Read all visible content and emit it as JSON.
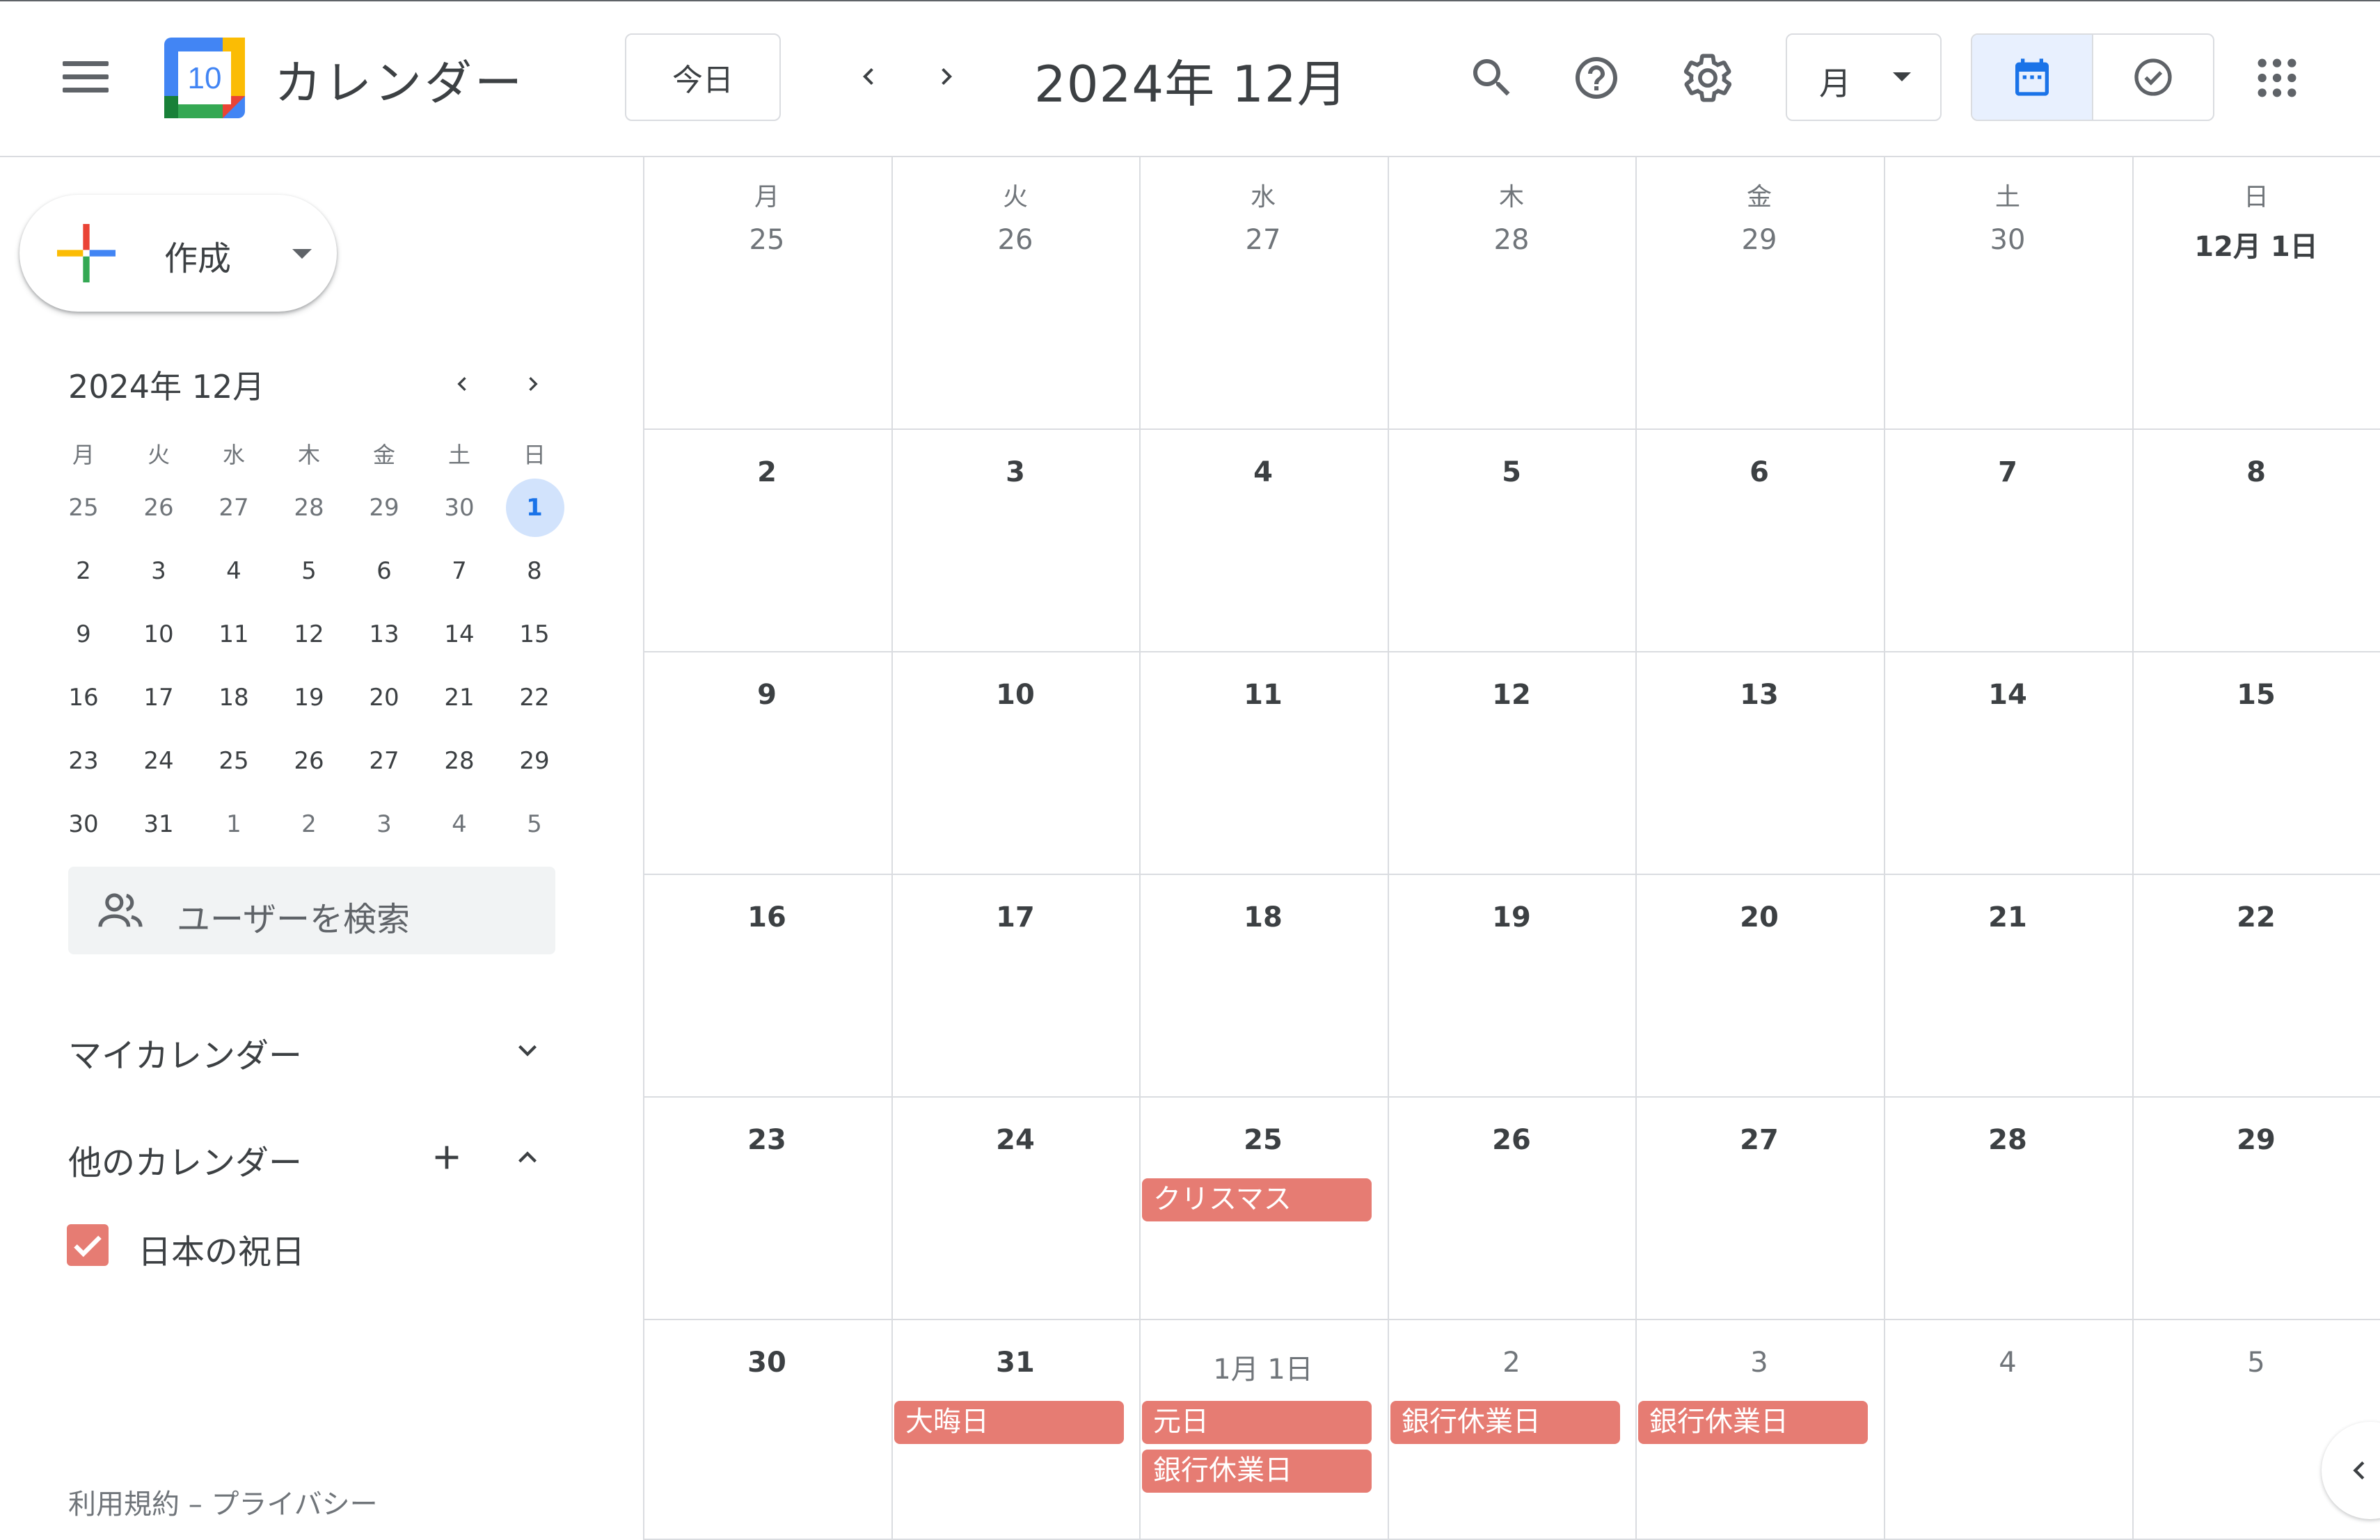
{
  "header": {
    "app_title": "カレンダー",
    "logo_day": "10",
    "today_label": "今日",
    "period_title": "2024年 12月",
    "view_select_label": "月"
  },
  "sidebar": {
    "create_label": "作成",
    "mini_calendar": {
      "title": "2024年 12月",
      "weekdays": [
        "月",
        "火",
        "水",
        "木",
        "金",
        "土",
        "日"
      ],
      "weeks": [
        [
          "25",
          "26",
          "27",
          "28",
          "29",
          "30",
          "1"
        ],
        [
          "2",
          "3",
          "4",
          "5",
          "6",
          "7",
          "8"
        ],
        [
          "9",
          "10",
          "11",
          "12",
          "13",
          "14",
          "15"
        ],
        [
          "16",
          "17",
          "18",
          "19",
          "20",
          "21",
          "22"
        ],
        [
          "23",
          "24",
          "25",
          "26",
          "27",
          "28",
          "29"
        ],
        [
          "30",
          "31",
          "1",
          "2",
          "3",
          "4",
          "5"
        ]
      ],
      "today": "1"
    },
    "user_search_placeholder": "ユーザーを検索",
    "my_calendars_label": "マイカレンダー",
    "other_calendars_label": "他のカレンダー",
    "other_calendars": [
      {
        "name": "日本の祝日",
        "color": "#e67c73",
        "checked": true
      }
    ],
    "footer": {
      "terms": "利用規約",
      "separator": "–",
      "privacy": "プライバシー"
    }
  },
  "month_grid": {
    "weekdays": [
      "月",
      "火",
      "水",
      "木",
      "金",
      "土",
      "日"
    ],
    "weeks": [
      [
        "25",
        "26",
        "27",
        "28",
        "29",
        "30",
        "12月 1日"
      ],
      [
        "2",
        "3",
        "4",
        "5",
        "6",
        "7",
        "8"
      ],
      [
        "9",
        "10",
        "11",
        "12",
        "13",
        "14",
        "15"
      ],
      [
        "16",
        "17",
        "18",
        "19",
        "20",
        "21",
        "22"
      ],
      [
        "23",
        "24",
        "25",
        "26",
        "27",
        "28",
        "29"
      ],
      [
        "30",
        "31",
        "1月 1日",
        "2",
        "3",
        "4",
        "5"
      ]
    ],
    "events": [
      {
        "week": 4,
        "day": 2,
        "slot": 0,
        "title": "クリスマス"
      },
      {
        "week": 5,
        "day": 1,
        "slot": 0,
        "title": "大晦日"
      },
      {
        "week": 5,
        "day": 2,
        "slot": 0,
        "title": "元日"
      },
      {
        "week": 5,
        "day": 2,
        "slot": 1,
        "title": "銀行休業日"
      },
      {
        "week": 5,
        "day": 3,
        "slot": 0,
        "title": "銀行休業日"
      },
      {
        "week": 5,
        "day": 4,
        "slot": 0,
        "title": "銀行休業日"
      }
    ]
  },
  "colors": {
    "accent": "#1a73e8",
    "holiday_event": "#e67c73",
    "today_highlight": "#d2e3fc",
    "view_toggle_active": "#e8f0fe"
  },
  "icons": {
    "menu": "hamburger-menu-icon",
    "search": "search-icon",
    "help": "help-icon",
    "settings": "gear-icon",
    "apps": "apps-grid-icon",
    "calendar_view": "calendar-icon",
    "tasks_view": "task-check-icon"
  }
}
